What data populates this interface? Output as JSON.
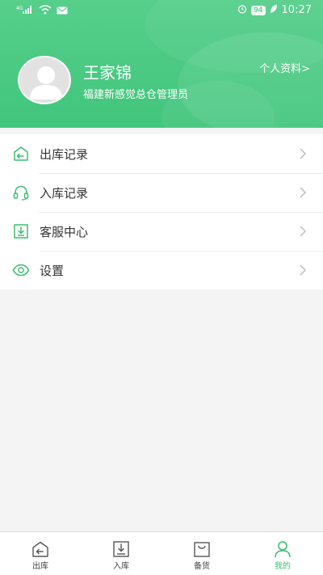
{
  "status_bar": {
    "battery": "94",
    "time": "10:27"
  },
  "profile": {
    "name": "王家锦",
    "org": "福建新感觉总仓管理员",
    "profile_link": "个人资料>"
  },
  "menu": {
    "items": [
      {
        "label": "出库记录",
        "icon": "outbound-icon"
      },
      {
        "label": "入库记录",
        "icon": "headset-icon"
      },
      {
        "label": "客服中心",
        "icon": "download-box-icon"
      },
      {
        "label": "设置",
        "icon": "eye-icon"
      }
    ]
  },
  "bottom_nav": {
    "items": [
      {
        "label": "出库",
        "icon": "outbound-icon"
      },
      {
        "label": "入库",
        "icon": "download-box-icon"
      },
      {
        "label": "备货",
        "icon": "bag-icon"
      },
      {
        "label": "我的",
        "icon": "user-icon",
        "active": true
      }
    ]
  },
  "colors": {
    "brand_green": "#41c57c",
    "icon_green": "#3bbf72",
    "text": "#333333",
    "background": "#f4f4f4"
  }
}
